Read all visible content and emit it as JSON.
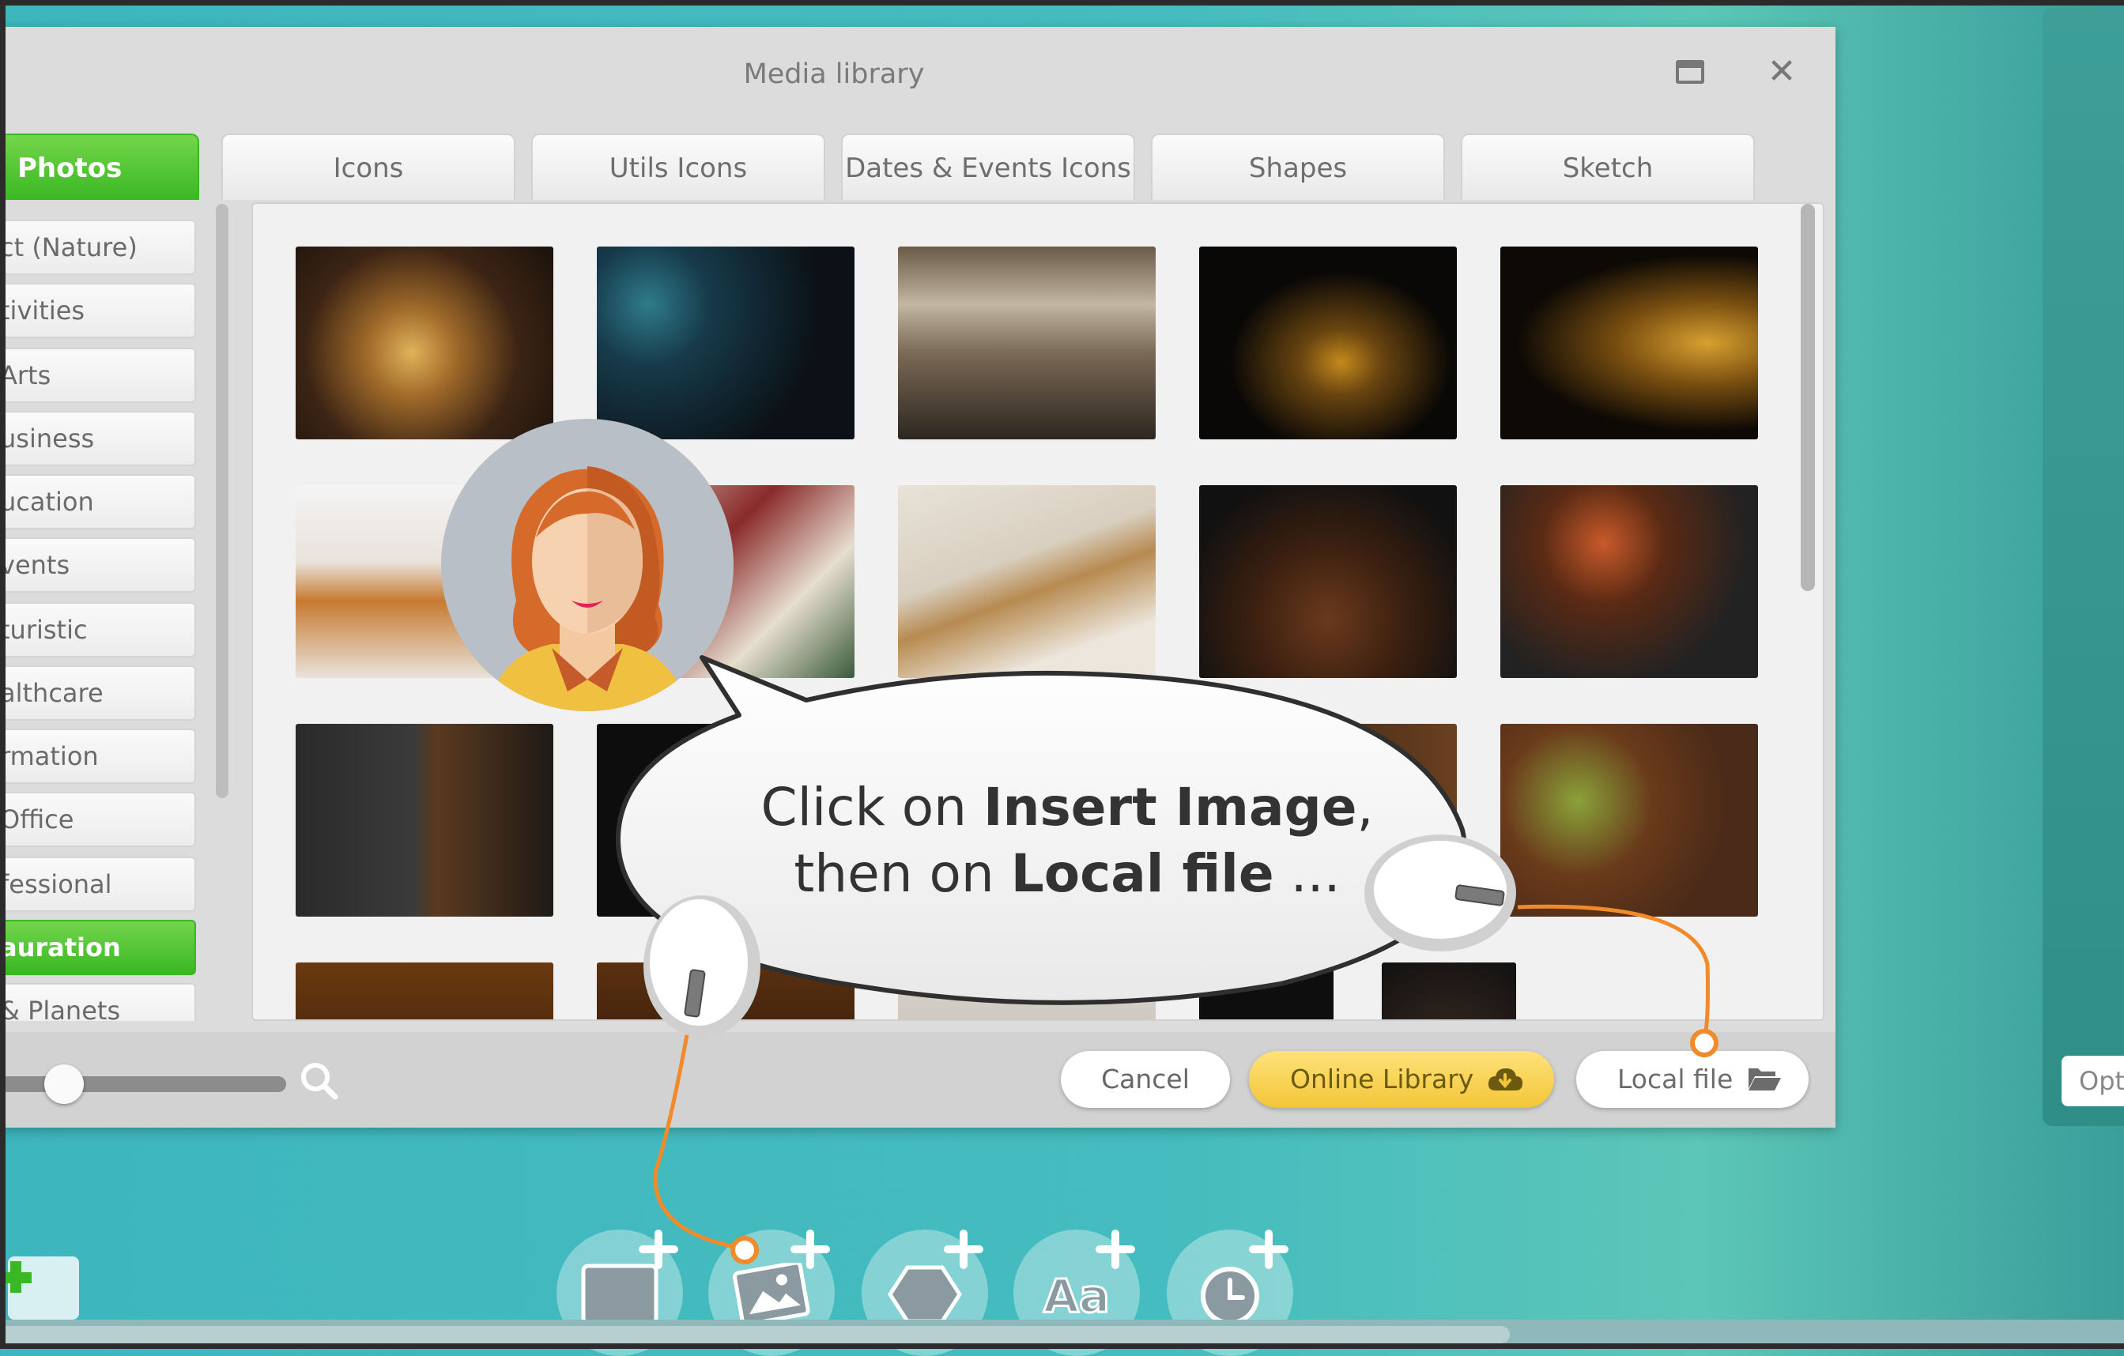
{
  "dialog": {
    "title": "Media library"
  },
  "tabs": [
    {
      "label": "Photos",
      "active": true
    },
    {
      "label": "Icons"
    },
    {
      "label": "Utils Icons"
    },
    {
      "label": "Dates & Events Icons"
    },
    {
      "label": "Shapes"
    },
    {
      "label": "Sketch"
    }
  ],
  "categories": [
    {
      "label": "ct (Nature)"
    },
    {
      "label": "tivities"
    },
    {
      "label": " Arts"
    },
    {
      "label": "usiness"
    },
    {
      "label": "ucation"
    },
    {
      "label": "vents"
    },
    {
      "label": "turistic"
    },
    {
      "label": "althcare"
    },
    {
      "label": "rmation"
    },
    {
      "label": "Office"
    },
    {
      "label": "fessional"
    },
    {
      "label": "auration",
      "active": true
    },
    {
      "label": "& Planets"
    }
  ],
  "buttons": {
    "cancel": "Cancel",
    "online_library": "Online Library",
    "local_file": "Local file"
  },
  "side": {
    "options_label": "Opt"
  },
  "callout": {
    "line1_pre": "Click on ",
    "line1_bold": "Insert Image",
    "line1_post": ",",
    "line2_pre": "then on ",
    "line2_bold": "Local file",
    "line2_post": " ..."
  },
  "toolbar": [
    {
      "icon": "rectangle-icon"
    },
    {
      "icon": "insert-image-icon"
    },
    {
      "icon": "hexagon-icon"
    },
    {
      "icon": "text-icon",
      "label": "Aa"
    },
    {
      "icon": "clock-icon"
    }
  ],
  "colors": {
    "accent_green": "#3ab823",
    "accent_yellow": "#f3c638",
    "callout_line": "#f08a2a"
  }
}
